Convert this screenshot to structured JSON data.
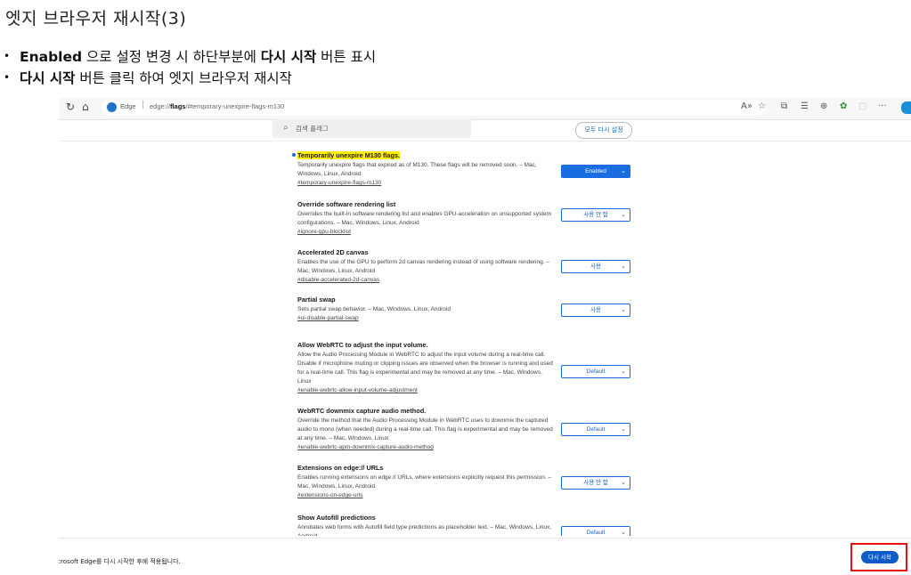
{
  "slide": {
    "title": "엣지 브라우저 재시작(3)",
    "bullet1": {
      "b1": "Enabled",
      "t1": " 으로 설정 변경 시 하단부분에 ",
      "b2": "다시 시작",
      "t2": " 버튼 표시"
    },
    "bullet2": {
      "b1": "다시 시작",
      "t1": " 버튼 클릭 하여 엣지 브라우저 재시작"
    }
  },
  "browser": {
    "site_label": "Edge",
    "url_prefix": "edge://",
    "url_bold": "flags",
    "url_rest": "/#temporary-unexpire-flags-m130",
    "search_placeholder": "검색 플래그",
    "reset_all_label": "모두 다시 설정",
    "flags": [
      {
        "title": "Temporarily unexpire M130 flags.",
        "desc": "Temporarily unexpire flags that expired as of M130. These flags will be removed soon. – Mac, Windows, Linux, Android",
        "link": "#temporary-unexpire-flags-m130",
        "value": "Enabled"
      },
      {
        "title": "Override software rendering list",
        "desc": "Overrides the built-in software rendering list and enables GPU-acceleration on unsupported system configurations. – Mac, Windows, Linux, Android",
        "link": "#ignore-gpu-blocklist",
        "value": "사용 안 함"
      },
      {
        "title": "Accelerated 2D canvas",
        "desc": "Enables the use of the GPU to perform 2d canvas rendering instead of using software rendering. – Mac, Windows, Linux, Android",
        "link": "#disable-accelerated-2d-canvas",
        "value": "사용"
      },
      {
        "title": "Partial swap",
        "desc": "Sets partial swap behavior. – Mac, Windows, Linux, Android",
        "link": "#ui-disable-partial-swap",
        "value": "사용"
      },
      {
        "title": "Allow WebRTC to adjust the input volume.",
        "desc": "Allow the Audio Processing Module in WebRTC to adjust the input volume during a real-time call. Disable if microphone muting or clipping issues are observed when the browser is running and used for a real-time call. This flag is experimental and may be removed at any time. – Mac, Windows, Linux",
        "link": "#enable-webrtc-allow-input-volume-adjustment",
        "value": "Default"
      },
      {
        "title": "WebRTC downmix capture audio method.",
        "desc": "Override the method that the Audio Processing Module in WebRTC uses to downmix the captured audio to mono (when needed) during a real-time call. This flag is experimental and may be removed at any time. – Mac, Windows, Linux",
        "link": "#enable-webrtc-apm-downmix-capture-audio-method",
        "value": "Default"
      },
      {
        "title": "Extensions on edge:// URLs",
        "desc": "Enables running extensions on edge:// URLs, where extensions explicitly request this permission. – Mac, Windows, Linux, Android",
        "link": "#extensions-on-edge-urls",
        "value": "사용 안 함"
      },
      {
        "title": "Show Autofill predictions",
        "desc": "Annotates web forms with Autofill field type predictions as placeholder text. – Mac, Windows, Linux, Android",
        "link": "",
        "value": "Default"
      }
    ],
    "bottom_message": "경 내용은 Microsoft Edge를 다시 시작한 후에 적용됩니다.",
    "restart_label": "다시 시작"
  }
}
